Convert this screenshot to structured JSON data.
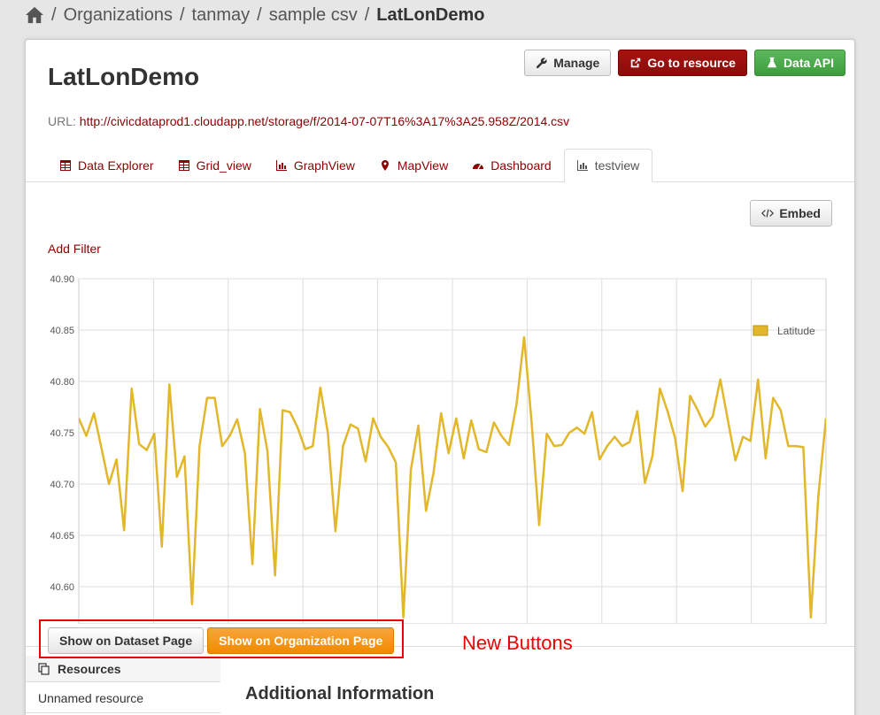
{
  "breadcrumb": {
    "items": [
      "Organizations",
      "tanmay",
      "sample csv"
    ],
    "current": "LatLonDemo",
    "separator": "/"
  },
  "dataset": {
    "title": "LatLonDemo",
    "url_label": "URL:",
    "url": "http://civicdataprod1.cloudapp.net/storage/f/2014-07-07T16%3A17%3A25.958Z/2014.csv"
  },
  "actions": {
    "manage": "Manage",
    "go_to_resource": "Go to resource",
    "data_api": "Data API"
  },
  "tabs": [
    {
      "label": "Data Explorer",
      "icon": "table-icon"
    },
    {
      "label": "Grid_view",
      "icon": "table-icon"
    },
    {
      "label": "GraphView",
      "icon": "bar-chart-icon"
    },
    {
      "label": "MapView",
      "icon": "map-marker-icon"
    },
    {
      "label": "Dashboard",
      "icon": "dashboard-icon"
    },
    {
      "label": "testview",
      "icon": "bar-chart-icon",
      "active": true
    }
  ],
  "embed": "Embed",
  "add_filter": "Add Filter",
  "chart_data": {
    "type": "line",
    "series": [
      {
        "name": "Latitude",
        "color": "#e2b72a",
        "values": [
          40.764,
          40.747,
          40.769,
          40.735,
          40.7,
          40.724,
          40.655,
          40.793,
          40.739,
          40.733,
          40.749,
          40.639,
          40.797,
          40.707,
          40.727,
          40.583,
          40.737,
          40.784,
          40.784,
          40.737,
          40.747,
          40.763,
          40.73,
          40.622,
          40.773,
          40.732,
          40.611,
          40.772,
          40.77,
          40.755,
          40.734,
          40.737,
          40.794,
          40.75,
          40.654,
          40.737,
          40.758,
          40.754,
          40.722,
          40.764,
          40.746,
          40.736,
          40.721,
          40.57,
          40.714,
          40.757,
          40.674,
          40.711,
          40.769,
          40.73,
          40.764,
          40.725,
          40.762,
          40.734,
          40.731,
          40.76,
          40.747,
          40.738,
          40.778,
          40.843,
          40.76,
          40.66,
          40.749,
          40.737,
          40.738,
          40.75,
          40.755,
          40.749,
          40.77,
          40.724,
          40.737,
          40.746,
          40.737,
          40.741,
          40.771,
          40.701,
          40.727,
          40.793,
          40.771,
          40.745,
          40.693,
          40.786,
          40.772,
          40.756,
          40.766,
          40.802,
          40.762,
          40.723,
          40.746,
          40.742,
          40.802,
          40.725,
          40.784,
          40.772,
          40.737,
          40.737,
          40.736,
          40.57,
          40.69,
          40.764
        ]
      }
    ],
    "ylim": [
      40.575,
      40.9
    ],
    "yticks": [
      "40.90",
      "40.85",
      "40.80",
      "40.75",
      "40.70",
      "40.65",
      "40.60"
    ],
    "grid": true,
    "legend": "top-right"
  },
  "new_buttons": {
    "dataset_page": "Show on Dataset Page",
    "organization_page": "Show on Organization Page",
    "annotation": "New Buttons"
  },
  "sidebar": {
    "resources_heading": "Resources",
    "items": [
      "Unnamed resource"
    ]
  },
  "main": {
    "additional_heading": "Additional Information"
  }
}
